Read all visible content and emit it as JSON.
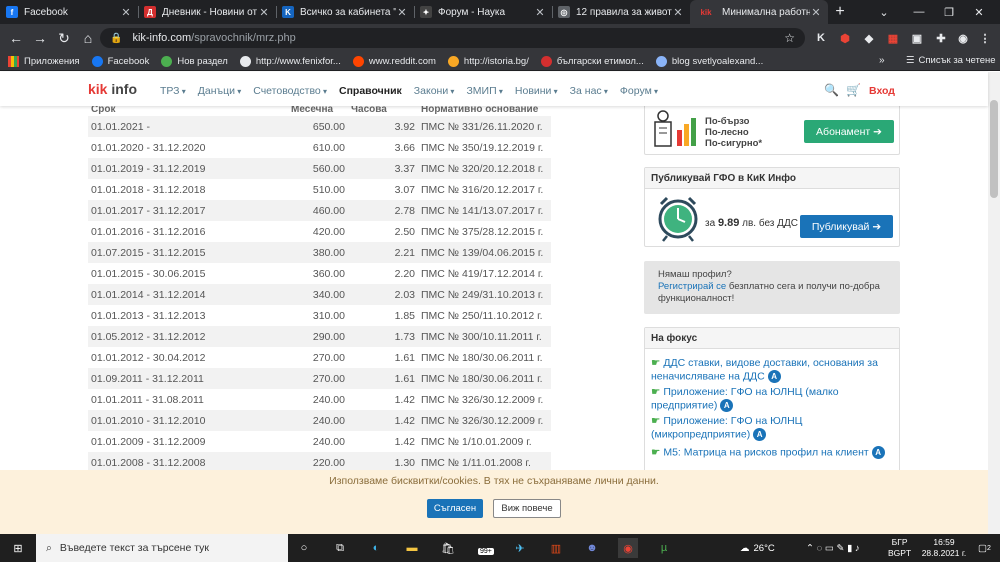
{
  "browser": {
    "tabs": [
      {
        "title": "Facebook",
        "favicon_color": "#1877f2",
        "glyph": "f"
      },
      {
        "title": "Дневник - Новини от",
        "favicon_color": "#d32f2f",
        "glyph": "Д"
      },
      {
        "title": "Всичко за кабинета \"П",
        "favicon_color": "#1565c0",
        "glyph": "K"
      },
      {
        "title": "Форум - Наука",
        "favicon_color": "#424242",
        "glyph": "✦"
      },
      {
        "title": "12 правила за живота",
        "favicon_color": "#5f6368",
        "glyph": "◎"
      },
      {
        "title": "Минимална работна",
        "favicon_color": "#e53935",
        "glyph": "kik",
        "active": true
      }
    ],
    "url_host": "kik-info.com",
    "url_path": "/spravochnik/mrz.php",
    "bookmarks": [
      {
        "label": "Приложения",
        "color": "#ea4335"
      },
      {
        "label": "Facebook",
        "color": "#1877f2"
      },
      {
        "label": "Нов раздел",
        "color": "#4caf50"
      },
      {
        "label": "http://www.fenixfor...",
        "color": "#e8eaed"
      },
      {
        "label": "www.reddit.com",
        "color": "#ff4500"
      },
      {
        "label": "http://istoria.bg/",
        "color": "#f9a825"
      },
      {
        "label": "български етимол...",
        "color": "#d32f2f"
      },
      {
        "label": "blog svetlyoalexand...",
        "color": "#8ab4f8"
      }
    ],
    "reading_list": "Списък за четене"
  },
  "site": {
    "logo_kik": "kik",
    "logo_info": "info",
    "menu": [
      "ТРЗ",
      "Данъци",
      "Счетоводство",
      "Справочник",
      "Закони",
      "ЗМИП",
      "Новини",
      "За нас",
      "Форум"
    ],
    "login": "Вход"
  },
  "table": {
    "headers": [
      "Срок",
      "Месечна",
      "Часова",
      "Нормативно основание"
    ],
    "rows": [
      [
        "01.01.2021 -",
        "650.00",
        "3.92",
        "ПМС № 331/26.11.2020 г."
      ],
      [
        "01.01.2020 - 31.12.2020",
        "610.00",
        "3.66",
        "ПМС № 350/19.12.2019 г."
      ],
      [
        "01.01.2019 - 31.12.2019",
        "560.00",
        "3.37",
        "ПМС № 320/20.12.2018 г."
      ],
      [
        "01.01.2018 - 31.12.2018",
        "510.00",
        "3.07",
        "ПМС № 316/20.12.2017 г."
      ],
      [
        "01.01.2017 - 31.12.2017",
        "460.00",
        "2.78",
        "ПМС № 141/13.07.2017 г."
      ],
      [
        "01.01.2016 - 31.12.2016",
        "420.00",
        "2.50",
        "ПМС № 375/28.12.2015 г."
      ],
      [
        "01.07.2015 - 31.12.2015",
        "380.00",
        "2.21",
        "ПМС № 139/04.06.2015 г."
      ],
      [
        "01.01.2015 - 30.06.2015",
        "360.00",
        "2.20",
        "ПМС № 419/17.12.2014 г."
      ],
      [
        "01.01.2014 - 31.12.2014",
        "340.00",
        "2.03",
        "ПМС № 249/31.10.2013 г."
      ],
      [
        "01.01.2013 - 31.12.2013",
        "310.00",
        "1.85",
        "ПМС № 250/11.10.2012 г."
      ],
      [
        "01.05.2012 - 31.12.2012",
        "290.00",
        "1.73",
        "ПМС № 300/10.11.2011 г."
      ],
      [
        "01.01.2012 - 30.04.2012",
        "270.00",
        "1.61",
        "ПМС № 180/30.06.2011 г."
      ],
      [
        "01.09.2011 - 31.12.2011",
        "270.00",
        "1.61",
        "ПМС № 180/30.06.2011 г."
      ],
      [
        "01.01.2011 - 31.08.2011",
        "240.00",
        "1.42",
        "ПМС № 326/30.12.2009 г."
      ],
      [
        "01.01.2010 - 31.12.2010",
        "240.00",
        "1.42",
        "ПМС № 326/30.12.2009 г."
      ],
      [
        "01.01.2009 - 31.12.2009",
        "240.00",
        "1.42",
        "ПМС № 1/10.01.2009 г."
      ],
      [
        "01.01.2008 - 31.12.2008",
        "220.00",
        "1.30",
        "ПМС № 1/11.01.2008 г."
      ]
    ]
  },
  "sidebar": {
    "promo_lines": [
      "По-бързо",
      "По-лесно",
      "По-сигурно*"
    ],
    "subscribe_button": "Абонамент",
    "publish_title": "Публикувай ГФО в КиК Инфо",
    "price_prefix": "за",
    "price_value": "9.89",
    "price_suffix": "лв. без ДДС",
    "publish_button": "Публикувай",
    "noprofile_q": "Нямаш профил?",
    "noprofile_link": "Регистрирай се",
    "noprofile_rest": " безплатно сега и получи по-добра функционалност!",
    "focus_title": "На фокус",
    "focus_items": [
      "ДДС ставки, видове доставки, основания за неначисляване на ДДС",
      "Приложение: ГФО на ЮЛНЦ (малко предприятие)",
      "Приложение: ГФО на ЮЛНЦ (микропредприятие)",
      "М5: Матрица на рисков профил на клиент"
    ],
    "badge_letter": "A"
  },
  "cookie": {
    "message": "Използваме бисквитки/cookies. В тях не съхраняваме лични данни.",
    "accept": "Съгласен",
    "more": "Виж повече"
  },
  "taskbar": {
    "search_placeholder": "Въведете текст за търсене тук",
    "temperature": "26°C",
    "lang1": "БГР",
    "lang2": "BGPT",
    "time": "16:59",
    "date": "28.8.2021 г.",
    "notif_count": "2",
    "store_badge": "99+"
  }
}
